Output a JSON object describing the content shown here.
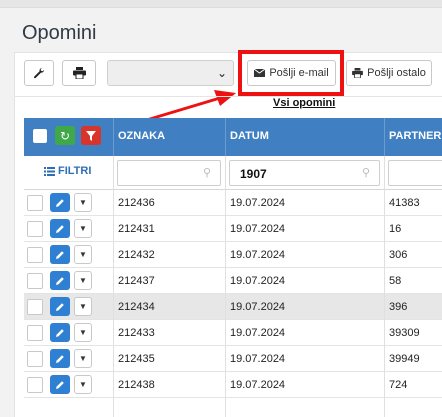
{
  "page": {
    "title": "Opomini"
  },
  "toolbar": {
    "email_label": "Pošlji e-mail",
    "other_label": "Pošlji ostalo",
    "select_value": ""
  },
  "tab": {
    "label": "Vsi opomini"
  },
  "grid": {
    "columns": [
      "OZNAKA",
      "DATUM",
      "PARTNER"
    ],
    "filters_label": "FILTRI",
    "filter_values": {
      "oznaka": "",
      "datum": "1907",
      "partner": ""
    },
    "rows": [
      {
        "oznaka": "212436",
        "datum": "19.07.2024",
        "partner": "41383"
      },
      {
        "oznaka": "212431",
        "datum": "19.07.2024",
        "partner": "16"
      },
      {
        "oznaka": "212432",
        "datum": "19.07.2024",
        "partner": "306"
      },
      {
        "oznaka": "212437",
        "datum": "19.07.2024",
        "partner": "58"
      },
      {
        "oznaka": "212434",
        "datum": "19.07.2024",
        "partner": "396"
      },
      {
        "oznaka": "212433",
        "datum": "19.07.2024",
        "partner": "39309"
      },
      {
        "oznaka": "212435",
        "datum": "19.07.2024",
        "partner": "39949"
      },
      {
        "oznaka": "212438",
        "datum": "19.07.2024",
        "partner": "724"
      }
    ]
  },
  "colors": {
    "header_blue": "#3f7fc2",
    "refresh_green": "#3fa94a",
    "filter_red": "#d9342b",
    "edit_blue": "#2f7fd3",
    "annotation_red": "#ee1111"
  },
  "icons": [
    "wrench-icon",
    "printer-icon",
    "envelope-icon",
    "printer-icon",
    "refresh-icon",
    "filter-icon",
    "list-icon",
    "search-icon",
    "pencil-icon",
    "caret-down-icon"
  ]
}
